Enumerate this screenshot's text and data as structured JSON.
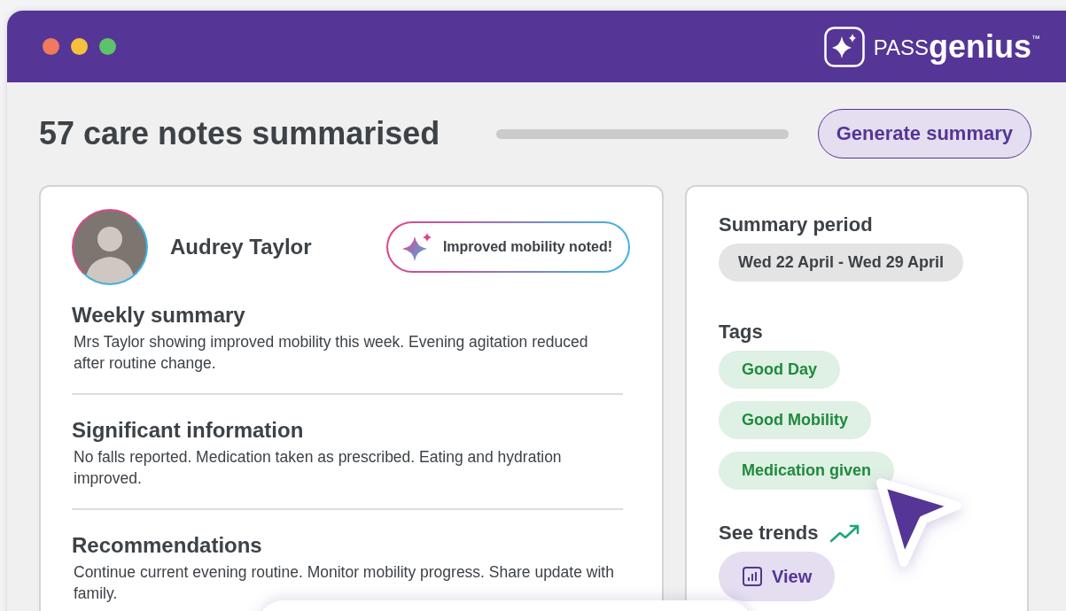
{
  "window": {
    "brand": {
      "prefix": "PASS",
      "name": "genius",
      "mark": "™"
    }
  },
  "header": {
    "title": "57 care notes summarised",
    "button": "Generate summary"
  },
  "resident": {
    "name": "Audrey Taylor",
    "badge": "Improved mobility noted!"
  },
  "sections": [
    {
      "heading": "Weekly summary",
      "text": "Mrs Taylor showing improved mobility this week. Evening agitation reduced after routine change."
    },
    {
      "heading": "Significant information",
      "text": "No falls reported. Medication taken as prescribed. Eating and hydration improved."
    },
    {
      "heading": "Recommendations",
      "text": "Continue current evening routine. Monitor mobility progress. Share update with family."
    }
  ],
  "side": {
    "period_label": "Summary period",
    "period": "Wed 22 April - Wed 29 April",
    "tags_label": "Tags",
    "tags": [
      "Good Day",
      "Good Mobility",
      "Medication given"
    ],
    "trends_label": "See trends",
    "view_button": "View"
  }
}
